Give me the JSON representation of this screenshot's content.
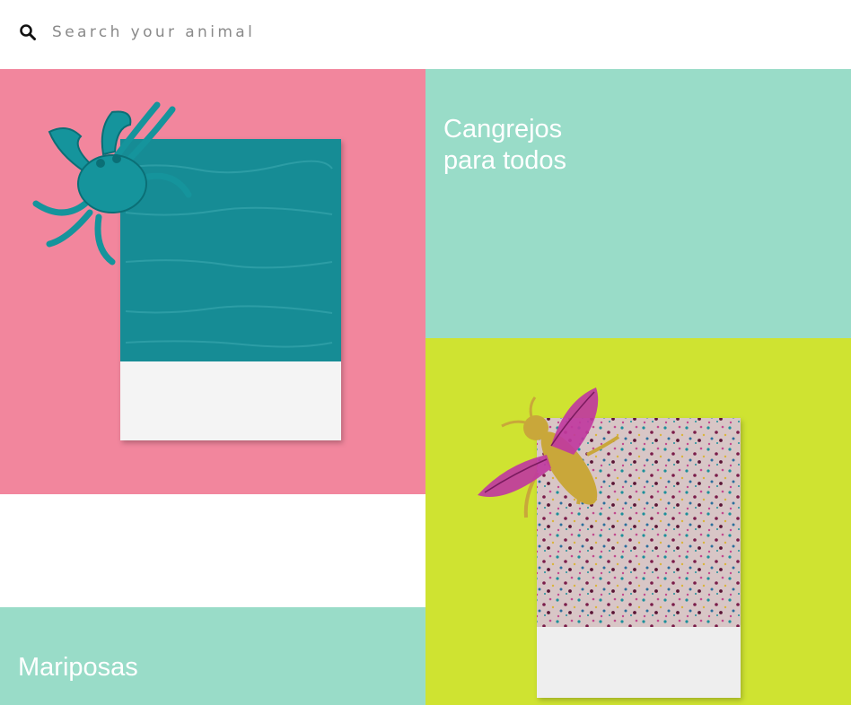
{
  "search": {
    "placeholder": "Search your animal",
    "icon": "search-icon"
  },
  "tiles": {
    "crab_photo": {
      "subject": "crab",
      "background": "#f2869d"
    },
    "crabs_card": {
      "title_line1": "Cangrejos",
      "title_line2": "para todos",
      "background": "#99dcc8"
    },
    "butterflies_card": {
      "title": "Mariposas",
      "background": "#99dcc8"
    },
    "insect_photo": {
      "subject": "winged-insect",
      "background": "#cfe331"
    }
  },
  "colors": {
    "pink": "#f2869d",
    "mint": "#99dcc8",
    "lime": "#cfe331",
    "teal": "#128c95",
    "magenta": "#c0399e",
    "gold": "#c9a73a"
  }
}
